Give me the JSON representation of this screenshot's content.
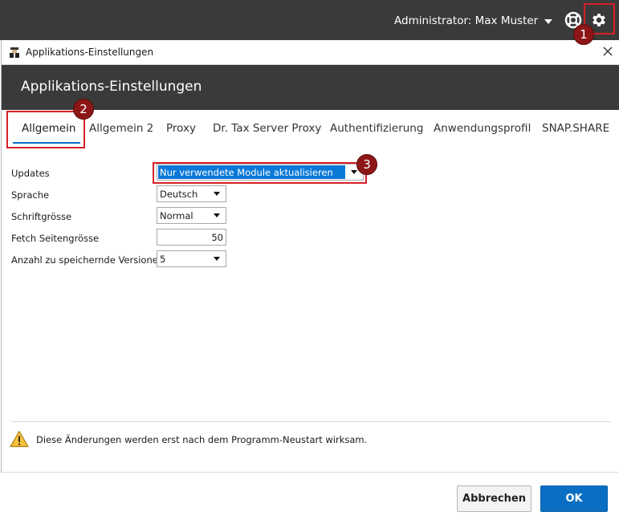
{
  "appbar": {
    "user_label": "Administrator: Max Muster",
    "bg_color": "#3a3a3a"
  },
  "window": {
    "title": "Applikations-Einstellungen",
    "close_glyph": "×"
  },
  "dialog": {
    "header_title": "Applikations-Einstellungen"
  },
  "tabs": [
    {
      "label": "Allgemein",
      "active": true
    },
    {
      "label": "Allgemein 2"
    },
    {
      "label": "Proxy"
    },
    {
      "label": "Dr. Tax Server Proxy"
    },
    {
      "label": "Authentifizierung"
    },
    {
      "label": "Anwendungsprofil"
    },
    {
      "label": "SNAP.SHARE"
    }
  ],
  "fields": {
    "updates": {
      "label": "Updates",
      "value": "Nur verwendete Module aktualisieren"
    },
    "sprache": {
      "label": "Sprache",
      "value": "Deutsch"
    },
    "schriftgroesse": {
      "label": "Schriftgrösse",
      "value": "Normal"
    },
    "fetch": {
      "label": "Fetch Seitengrösse",
      "value": "50"
    },
    "versionen": {
      "label": "Anzahl zu speichernde Versionen",
      "value": "5"
    }
  },
  "notice": {
    "text": "Diese Änderungen werden erst nach dem Programm-Neustart wirksam."
  },
  "buttons": {
    "cancel": "Abbrechen",
    "ok": "OK"
  },
  "annotations": [
    "1",
    "2",
    "3"
  ],
  "colors": {
    "accent": "#0a6fc2",
    "annotation_red": "#d62027",
    "annotation_badge": "#8d1616"
  },
  "icons": {
    "help": "lifebuoy-icon",
    "settings": "gear-icon",
    "warning": "warning-icon",
    "app": "app-logo-icon"
  }
}
